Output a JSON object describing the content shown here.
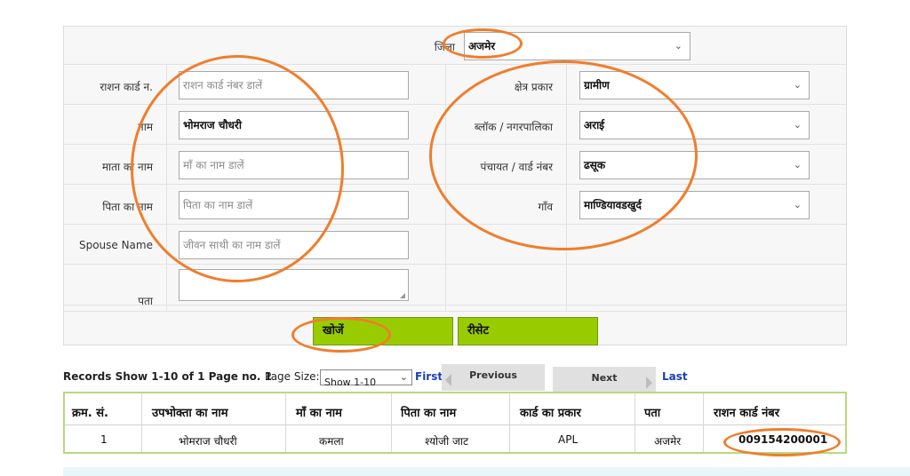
{
  "form": {
    "district": {
      "label": "जिला",
      "value": "अजमेर"
    },
    "ration_card": {
      "label": "राशन कार्ड न.",
      "placeholder": "राशन कार्ड नंबर डालें"
    },
    "name": {
      "label": "नाम",
      "value": "भोमराज चौधरी"
    },
    "mother_name": {
      "label": "माता का नाम",
      "placeholder": "माँ का नाम डालें"
    },
    "father_name": {
      "label": "पिता का नाम",
      "placeholder": "पिता का नाम डालें"
    },
    "spouse_name": {
      "label": "Spouse Name",
      "placeholder": "जीवन साथी का नाम डालें"
    },
    "address": {
      "label": "पता"
    },
    "area_type": {
      "label": "क्षेत्र प्रकार",
      "value": "ग्रामीण"
    },
    "block": {
      "label": "ब्लॉक / नगरपालिका",
      "value": "अराई"
    },
    "panchayat": {
      "label": "पंचायत / वार्ड नंबर",
      "value": "ढसूक"
    },
    "village": {
      "label": "गाँव",
      "value": "माण्डियावडखुर्द"
    },
    "search_button": "खोजें",
    "reset_button": "रीसेट"
  },
  "pager": {
    "records_label": "Records Show 1-10 of 1 Page no.",
    "page_no": "1",
    "page_size_label": "Page Size:",
    "page_size_value": "Show 1-10",
    "first": "First",
    "previous": "Previous",
    "next": "Next",
    "last": "Last"
  },
  "results": {
    "headers": [
      "क्रम. सं.",
      "उपभोक्ता का नाम",
      "माँ का नाम",
      "पिता का नाम",
      "कार्ड का प्रकार",
      "पता",
      "राशन कार्ड नंबर"
    ],
    "rows": [
      [
        "1",
        "भोमराज चौधरी",
        "कमला",
        "श्योजी जाट",
        "APL",
        "अजमेर",
        "009154200001"
      ]
    ]
  },
  "colors": {
    "accent_green": "#99cc00",
    "annotation_orange": "#f07d2c",
    "link_blue": "#1a3fb5"
  }
}
